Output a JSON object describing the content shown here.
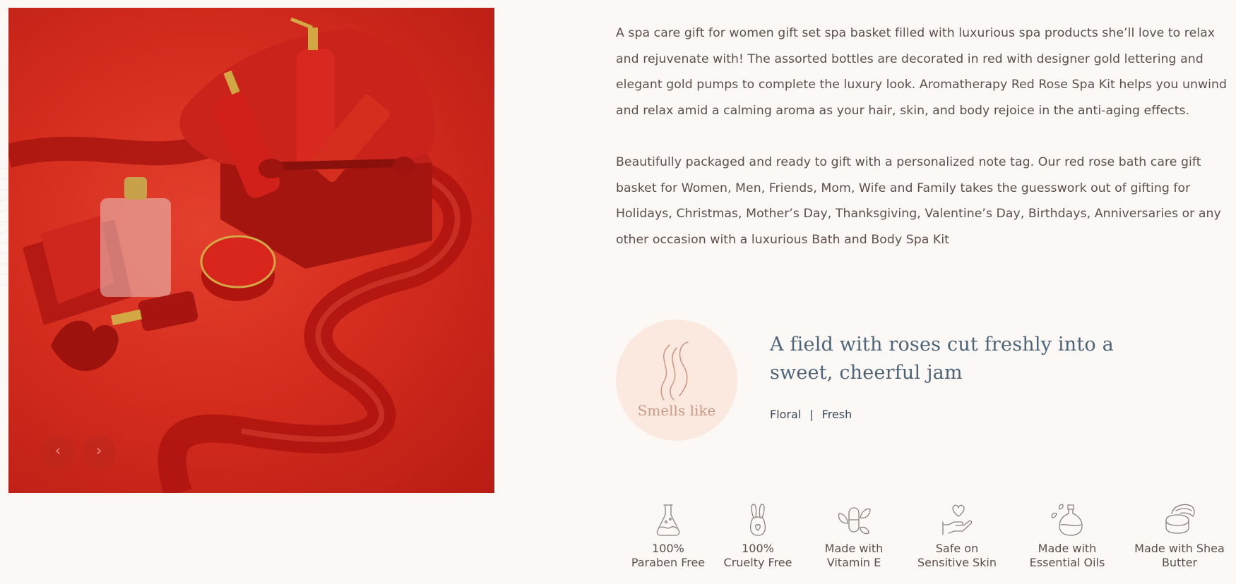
{
  "gallery": {
    "prev_arrow": "‹",
    "next_arrow": "›",
    "image_alt": "Enchanted Red Rose spa gift basket with bottles, jar, roller and red ribbon"
  },
  "description": {
    "paragraph_1": "A spa care gift for women gift set spa basket filled with luxurious spa products she’ll love to relax and rejuvenate with! The assorted bottles are decorated in red with designer gold lettering and elegant gold pumps to complete the luxury look. Aromatherapy Red Rose Spa Kit helps you unwind and relax amid a calming aroma as your hair, skin, and body rejoice in the anti-aging effects.",
    "paragraph_2": "Beautifully packaged and ready to gift with a personalized note tag. Our red rose bath care gift basket for Women, Men, Friends, Mom, Wife and Family takes the guesswork out of gifting for Holidays, Christmas, Mother’s Day, Thanksgiving, Valentine’s Day, Birthdays, Anniversaries or any other occasion with a luxurious Bath and Body Spa Kit"
  },
  "scent": {
    "label": "Smells like",
    "title": "A field with roses cut freshly into a sweet, cheerful jam",
    "notes": [
      "Floral",
      "Fresh"
    ],
    "separator": "|"
  },
  "features": [
    {
      "icon": "flask-icon",
      "line1": "100%",
      "line2": "Paraben Free"
    },
    {
      "icon": "bunny-icon",
      "line1": "100%",
      "line2": "Cruelty Free"
    },
    {
      "icon": "capsule-leaf-icon",
      "line1": "Made with",
      "line2": "Vitamin E"
    },
    {
      "icon": "hand-heart-icon",
      "line1": "Safe on",
      "line2": "Sensitive Skin"
    },
    {
      "icon": "oil-bottle-icon",
      "line1": "Made with",
      "line2": "Essential Oils"
    },
    {
      "icon": "butter-jar-icon",
      "line1": "Made with Shea",
      "line2": "Butter"
    }
  ],
  "colors": {
    "background": "#fcf8f5",
    "scent_title": "#4d6478",
    "scent_circle": "#fbe9df",
    "product_red": "#d52d1e"
  }
}
